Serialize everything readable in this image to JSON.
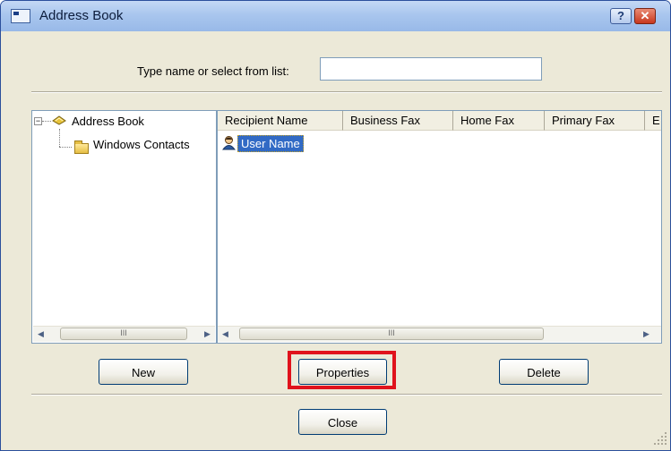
{
  "window": {
    "title": "Address Book",
    "help_label": "?",
    "close_label": "✕"
  },
  "search": {
    "label": "Type name or select from list:",
    "value": ""
  },
  "tree": {
    "items": [
      {
        "label": "Address Book"
      },
      {
        "label": "Windows Contacts"
      }
    ],
    "expander": "−"
  },
  "list": {
    "columns": [
      "Recipient Name",
      "Business Fax",
      "Home Fax",
      "Primary Fax",
      "E"
    ],
    "rows": [
      {
        "name": "User Name"
      }
    ]
  },
  "scrollbar": {
    "left_arrow": "◀",
    "right_arrow": "▶",
    "thumb_grip": "III"
  },
  "buttons": {
    "new": "New",
    "properties": "Properties",
    "delete": "Delete",
    "close": "Close"
  },
  "colors": {
    "highlight": "#e0121c",
    "selection": "#316ac5",
    "titlebar": "#a9c6ee"
  }
}
